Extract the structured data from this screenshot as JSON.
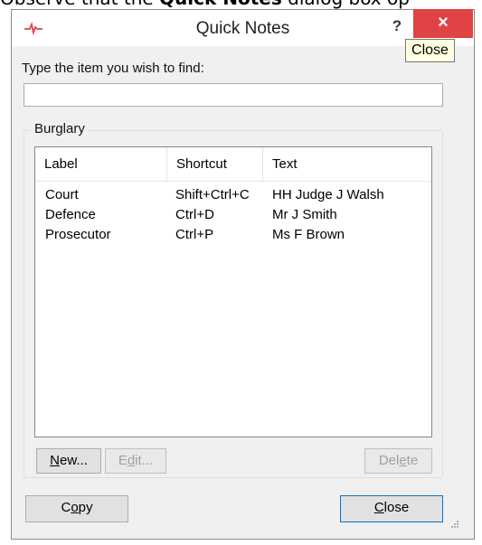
{
  "doc_text": {
    "prefix": "Observe that the ",
    "bold": "Quick Notes",
    "suffix": " dialog box op"
  },
  "window": {
    "title": "Quick Notes",
    "help_label": "?",
    "close_glyph": "×",
    "tooltip": "Close",
    "app_icon": "heartbeat-icon"
  },
  "find": {
    "prompt": "Type the item you wish to find:",
    "value": ""
  },
  "group": {
    "legend": "Burglary"
  },
  "list": {
    "columns": {
      "label": "Label",
      "shortcut": "Shortcut",
      "text": "Text"
    },
    "rows": [
      {
        "label": "Court",
        "shortcut": "Shift+Ctrl+C",
        "text": "HH Judge J Walsh"
      },
      {
        "label": "Defence",
        "shortcut": "Ctrl+D",
        "text": "Mr J Smith"
      },
      {
        "label": "Prosecutor",
        "shortcut": "Ctrl+P",
        "text": "Ms F Brown"
      }
    ]
  },
  "buttons": {
    "new": {
      "mnemonic": "N",
      "rest": "ew..."
    },
    "edit": {
      "pre": "E",
      "mnemonic": "d",
      "rest": "it..."
    },
    "delete": {
      "pre": "Del",
      "mnemonic": "e",
      "rest": "te"
    },
    "copy": {
      "pre": "C",
      "mnemonic": "o",
      "rest": "py"
    },
    "close": {
      "mnemonic": "C",
      "rest": "lose"
    }
  },
  "colors": {
    "close_button": "#e04343",
    "dialog_background": "#f0f0f0",
    "app_icon": "#e04343",
    "default_button_border": "#0078d7"
  }
}
